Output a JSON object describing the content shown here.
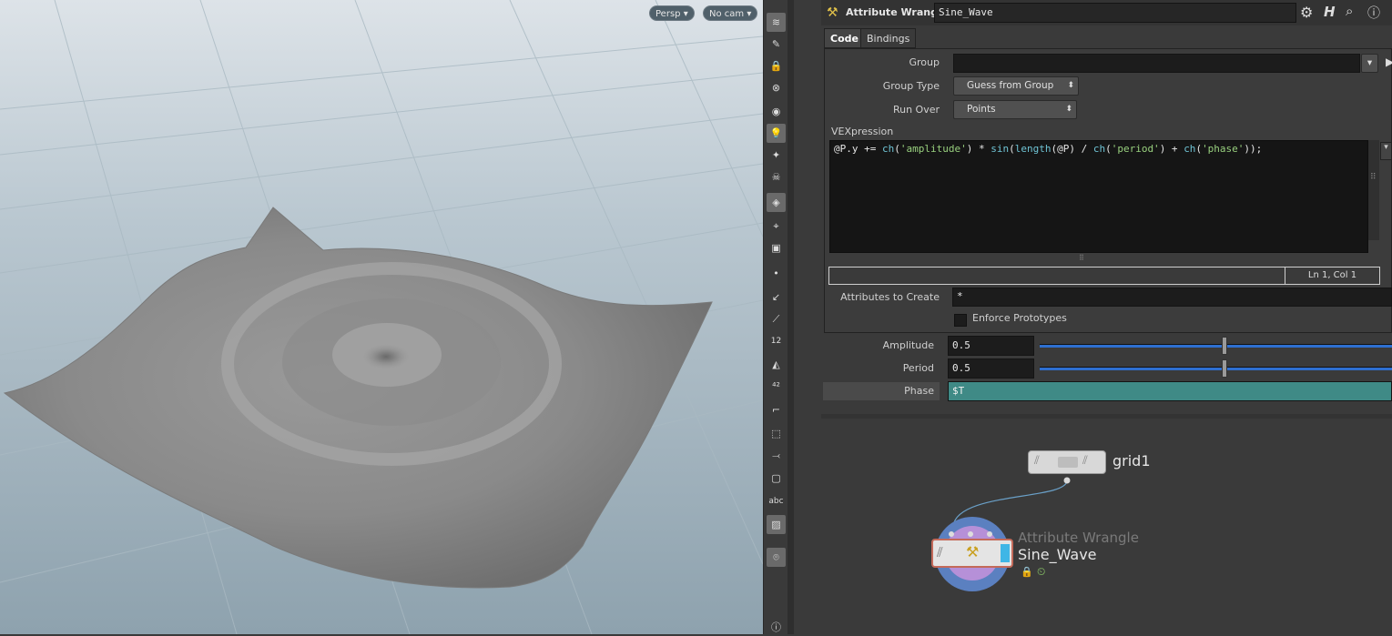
{
  "viewport": {
    "persp_label": "Persp",
    "cam_label": "No cam"
  },
  "node_header": {
    "type_label": "Attribute Wrangle",
    "name_value": "Sine_Wave"
  },
  "tabs": [
    {
      "label": "Code"
    },
    {
      "label": "Bindings"
    }
  ],
  "params": {
    "group_label": "Group",
    "group_value": "",
    "group_type_label": "Group Type",
    "group_type_value": "Guess from Group",
    "run_over_label": "Run Over",
    "run_over_value": "Points",
    "vex_label": "VEXpression",
    "cursor_pos": "Ln 1, Col 1",
    "attrs_label": "Attributes to Create",
    "attrs_value": "*",
    "enforce_label": "Enforce Prototypes",
    "amplitude_label": "Amplitude",
    "amplitude_value": "0.5",
    "amplitude_fraction": 0.5,
    "period_label": "Period",
    "period_value": "0.5",
    "period_fraction": 0.5,
    "phase_label": "Phase",
    "phase_value": "$T"
  },
  "code": {
    "t1": "@P.y += ",
    "t2": "ch",
    "t3": "(",
    "t4": "'amplitude'",
    "t5": ") * ",
    "t6": "sin",
    "t7": "(",
    "t8": "length",
    "t9": "(@P) / ",
    "t10": "ch",
    "t11": "(",
    "t12": "'period'",
    "t13": ") + ",
    "t14": "ch",
    "t15": "(",
    "t16": "'phase'",
    "t17": "));"
  },
  "network": {
    "grid_node_name": "grid1",
    "wrangle_node_type": "Attribute Wrangle",
    "wrangle_node_name": "Sine_Wave"
  },
  "toolbar_text": {
    "abc": "abc",
    "twelve": "12"
  },
  "colors": {
    "phase_bg": "#3f8a86",
    "slider": "#2e6fd0",
    "grid_node": "#d8d8d8",
    "wrangle_ring": "#5b80c0"
  }
}
